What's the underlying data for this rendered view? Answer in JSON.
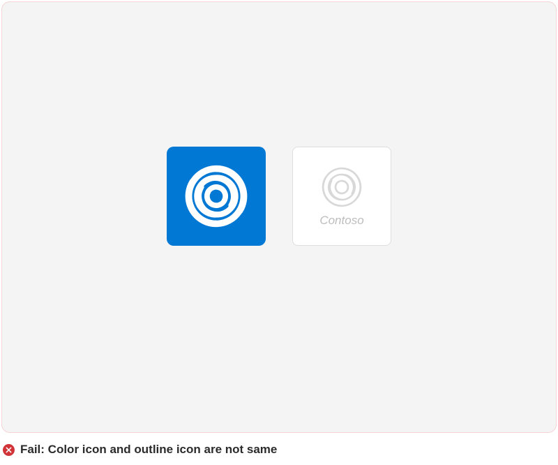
{
  "outline_tile": {
    "label": "Contoso"
  },
  "status": {
    "level": "fail",
    "text": "Fail: Color icon and outline icon are not same"
  },
  "colors": {
    "brand_blue": "#0078d4",
    "fail_red": "#d13438",
    "frame_bg": "#f4f4f4",
    "frame_border": "#f5d3d6"
  }
}
